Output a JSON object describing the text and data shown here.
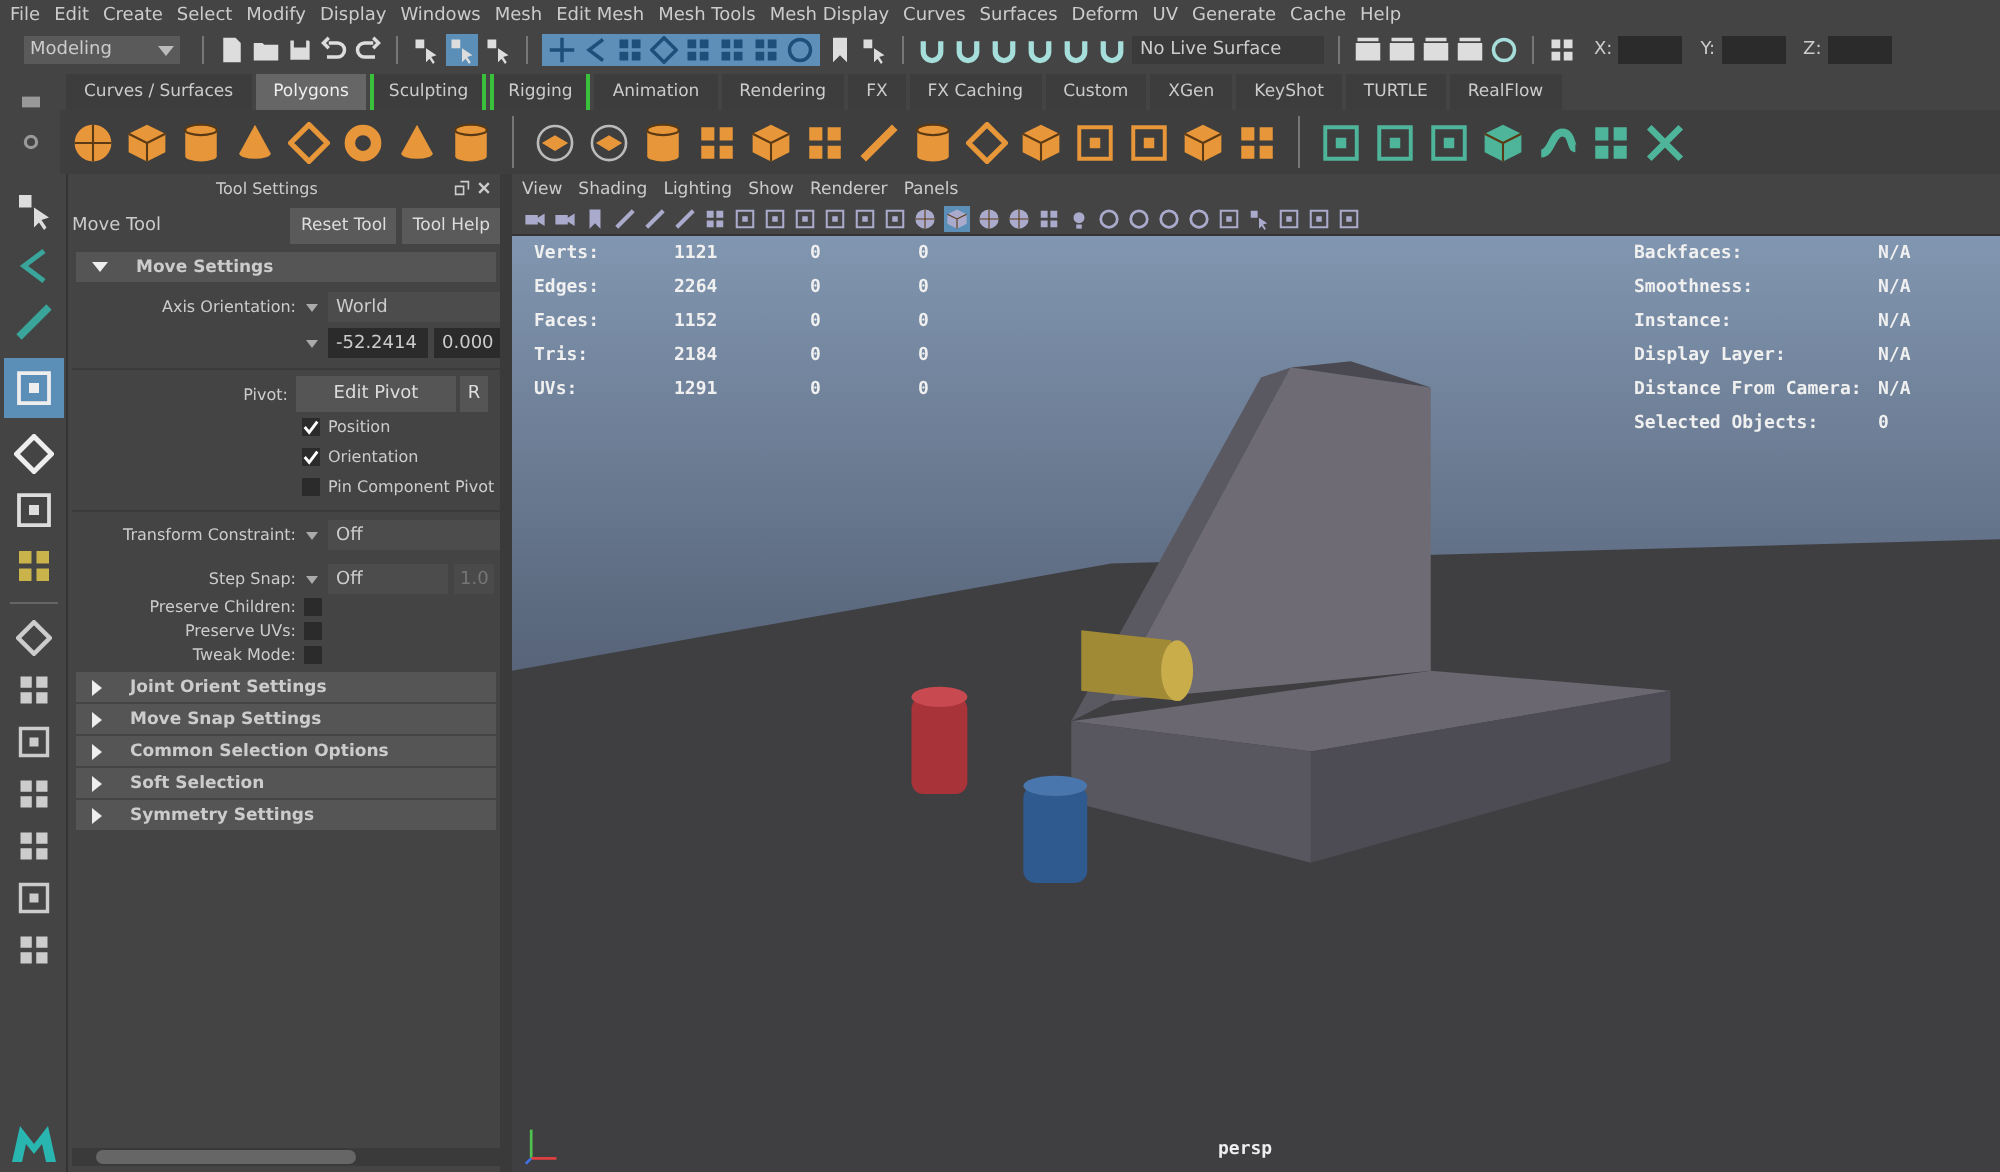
{
  "menu_bar": [
    "File",
    "Edit",
    "Create",
    "Select",
    "Modify",
    "Display",
    "Windows",
    "Mesh",
    "Edit Mesh",
    "Mesh Tools",
    "Mesh Display",
    "Curves",
    "Surfaces",
    "Deform",
    "UV",
    "Generate",
    "Cache",
    "Help"
  ],
  "status_line": {
    "mode": "Modeling",
    "live_surface": "No Live Surface",
    "coords": [
      {
        "label": "X:"
      },
      {
        "label": "Y:"
      },
      {
        "label": "Z:"
      }
    ]
  },
  "shelf_tabs": [
    {
      "label": "Curves / Surfaces",
      "selected": false,
      "bracketed": false
    },
    {
      "label": "Polygons",
      "selected": true,
      "bracketed": false
    },
    {
      "label": "Sculpting",
      "selected": false,
      "bracketed": true
    },
    {
      "label": "Rigging",
      "selected": false,
      "bracketed": true
    },
    {
      "label": "Animation",
      "selected": false,
      "bracketed": false
    },
    {
      "label": "Rendering",
      "selected": false,
      "bracketed": false
    },
    {
      "label": "FX",
      "selected": false,
      "bracketed": false
    },
    {
      "label": "FX Caching",
      "selected": false,
      "bracketed": false
    },
    {
      "label": "Custom",
      "selected": false,
      "bracketed": false
    },
    {
      "label": "XGen",
      "selected": false,
      "bracketed": false
    },
    {
      "label": "KeyShot",
      "selected": false,
      "bracketed": false
    },
    {
      "label": "TURTLE",
      "selected": false,
      "bracketed": false
    },
    {
      "label": "RealFlow",
      "selected": false,
      "bracketed": false
    }
  ],
  "tool_settings": {
    "title": "Tool Settings",
    "tool": "Move Tool",
    "buttons": [
      "Reset Tool",
      "Tool Help"
    ],
    "section": {
      "label": "Move Settings",
      "expanded": true
    },
    "axis_orientation": {
      "label": "Axis Orientation:",
      "value": "World",
      "values": [
        "-52.2414",
        "0.000"
      ]
    },
    "pivot": {
      "label": "Pivot:",
      "buttons": [
        "Edit Pivot",
        "R"
      ],
      "options": [
        {
          "label": "Position",
          "checked": true
        },
        {
          "label": "Orientation",
          "checked": true
        },
        {
          "label": "Pin Component Pivot",
          "checked": false
        }
      ]
    },
    "transform_constraint": {
      "label": "Transform Constraint:",
      "value": "Off"
    },
    "step_snap": {
      "label": "Step Snap:",
      "value": "Off",
      "amount": "1.0"
    },
    "toggles": [
      {
        "label": "Preserve Children:",
        "checked": false
      },
      {
        "label": "Preserve UVs:",
        "checked": false
      },
      {
        "label": "Tweak Mode:",
        "checked": false
      }
    ],
    "sections": [
      {
        "label": "Joint Orient Settings",
        "expanded": false
      },
      {
        "label": "Move Snap Settings",
        "expanded": false
      },
      {
        "label": "Common Selection Options",
        "expanded": false
      },
      {
        "label": "Soft Selection",
        "expanded": false
      },
      {
        "label": "Symmetry Settings",
        "expanded": false
      }
    ]
  },
  "viewport": {
    "menus": [
      "View",
      "Shading",
      "Lighting",
      "Show",
      "Renderer",
      "Panels"
    ],
    "stats": [
      {
        "label": "Verts:",
        "values": [
          "1121",
          "0",
          "0"
        ]
      },
      {
        "label": "Edges:",
        "values": [
          "2264",
          "0",
          "0"
        ]
      },
      {
        "label": "Faces:",
        "values": [
          "1152",
          "0",
          "0"
        ]
      },
      {
        "label": "Tris:",
        "values": [
          "2184",
          "0",
          "0"
        ]
      },
      {
        "label": "UVs:",
        "values": [
          "1291",
          "0",
          "0"
        ]
      }
    ],
    "info": [
      {
        "label": "Backfaces:",
        "value": "N/A"
      },
      {
        "label": "Smoothness:",
        "value": "N/A"
      },
      {
        "label": "Instance:",
        "value": "N/A"
      },
      {
        "label": "Display Layer:",
        "value": "N/A"
      },
      {
        "label": "Distance From Camera:",
        "value": "N/A"
      },
      {
        "label": "Selected Objects:",
        "value": "0"
      }
    ],
    "camera": "persp"
  }
}
